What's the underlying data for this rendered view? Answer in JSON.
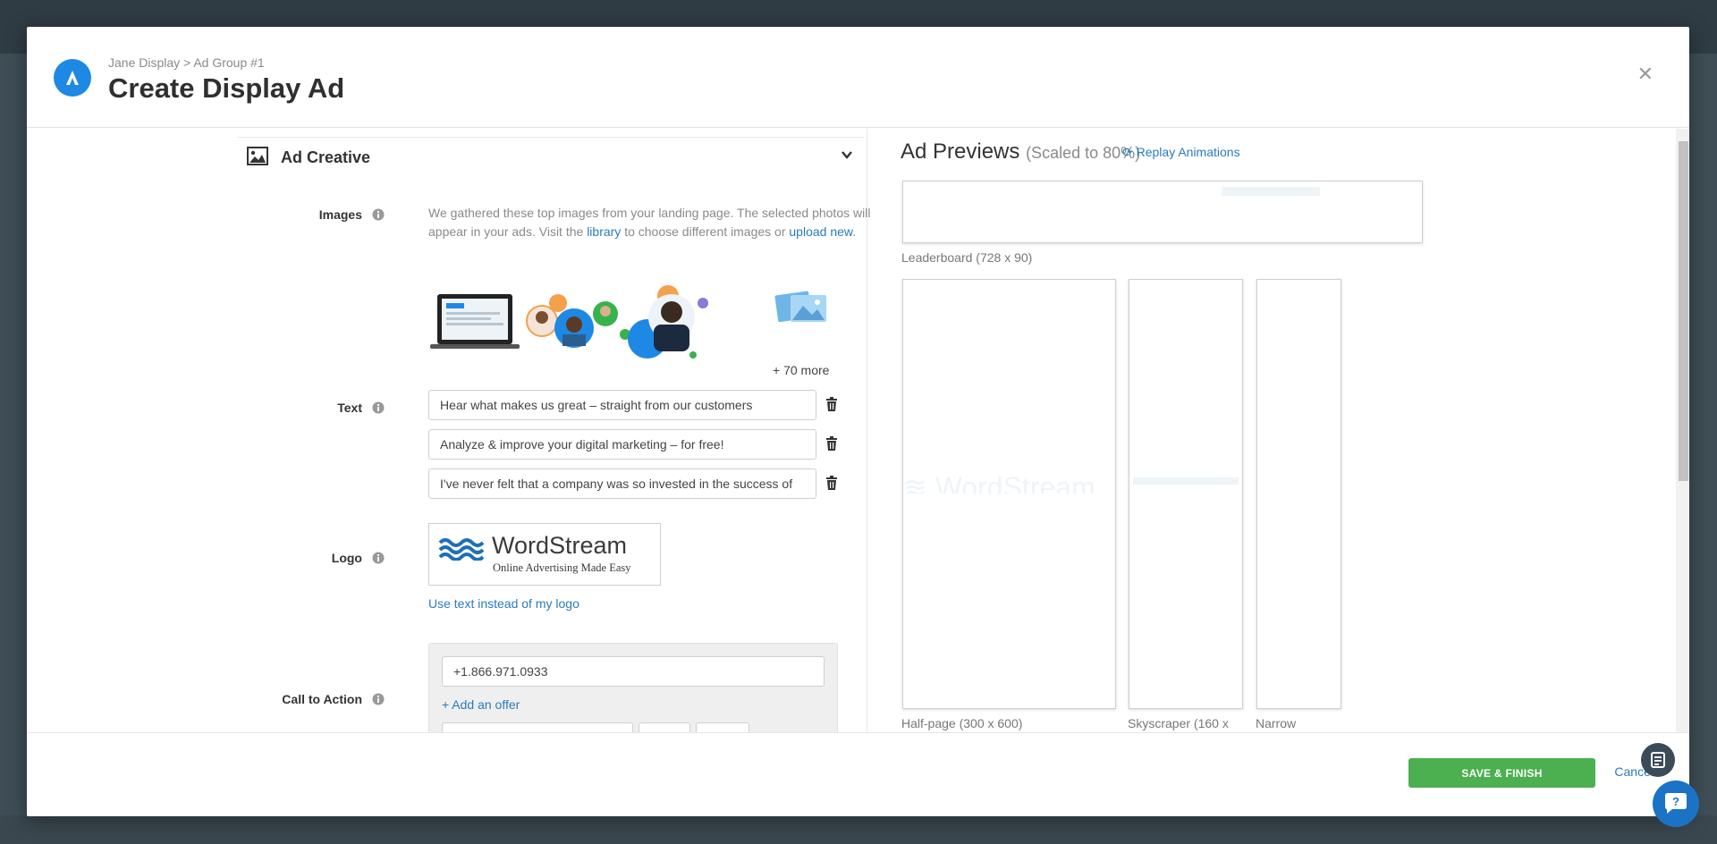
{
  "header": {
    "breadcrumb": "Jane Display > Ad Group #1",
    "title": "Create Display Ad"
  },
  "section": {
    "title": "Ad Creative"
  },
  "images": {
    "label": "Images",
    "help_part1": "We gathered these top images from your landing page. The selected photos will appear in your ads. Visit the ",
    "library_link": "library",
    "help_part2": " to choose different images or ",
    "upload_link": "upload new",
    "help_part3": ".",
    "more_count": "+ 70 more"
  },
  "text": {
    "label": "Text",
    "lines": [
      "Hear what makes us great – straight from our customers",
      "Analyze & improve your digital marketing – for free!",
      "I've never felt that a company was so invested in the success of"
    ]
  },
  "logo": {
    "label": "Logo",
    "brand_name": "WordStream",
    "tagline": "Online Advertising Made Easy",
    "use_text_link": "Use text instead of my logo"
  },
  "cta": {
    "label": "Call to Action",
    "phone_value": "+1.866.971.0933",
    "add_offer_link": "+ Add an offer"
  },
  "previews": {
    "title": "Ad Previews",
    "scale_note": "(Scaled to 80%)",
    "replay_label": "Replay Animations",
    "items": [
      {
        "caption": "Leaderboard (728 x 90)"
      },
      {
        "caption": "Half-page (300 x 600)"
      },
      {
        "caption": "Skyscraper (160 x"
      },
      {
        "caption": "Narrow"
      }
    ]
  },
  "footer": {
    "save_label": "SAVE & FINISH",
    "cancel_label": "Cancel"
  },
  "colors": {
    "accent_blue": "#1e88e5",
    "link_blue": "#2a7bbf",
    "save_green": "#4caf50"
  }
}
